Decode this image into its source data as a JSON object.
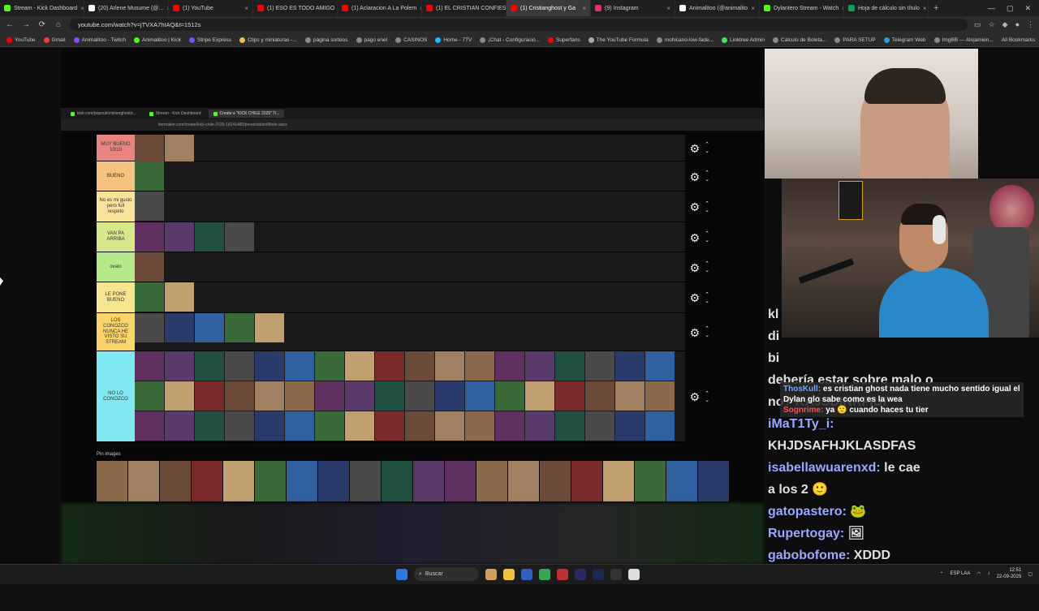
{
  "browser": {
    "tabs": [
      {
        "label": "Stream - Kick Dashboard",
        "color": "#53fc18"
      },
      {
        "label": "(20) Arlene Musume (@...",
        "color": "#ffffff"
      },
      {
        "label": "(1) YouTube",
        "color": "#ff0000"
      },
      {
        "label": "(1) ESO ES TODO AMIGO",
        "color": "#ff0000"
      },
      {
        "label": "(1) Aclaracion A La Polem",
        "color": "#ff0000"
      },
      {
        "label": "(1) EL CRISTIAN CONFIES",
        "color": "#ff0000"
      },
      {
        "label": "(1) Cristianghost y Ga",
        "color": "#ff0000"
      },
      {
        "label": "(9) Instagram",
        "color": "#e1306c"
      },
      {
        "label": "Animalitoo (@animalito",
        "color": "#ffffff"
      },
      {
        "label": "Dylantero Stream - Watch",
        "color": "#53fc18"
      },
      {
        "label": "Hoja de cálculo sin título",
        "color": "#0f9d58"
      }
    ],
    "url": "youtube.com/watch?v=jTVXA7hIAQ&t=1512s",
    "bookmarks": [
      "YouTube",
      "Gmail",
      "Animalitoo - Twitch",
      "Animalitoo | Kick",
      "Stripe Express",
      "Clips y miniaturas -...",
      "página sorteos",
      "pago enel",
      "CASINOS",
      "Home - 7TV",
      "¡Chat - Configuració...",
      "Superfans",
      "The YouTube Formula",
      "mohicano-low-fade...",
      "Linktree Admin",
      "Cálculo de Boleta...",
      "PARA SETUP",
      "Telegram Web",
      "ImgBB — Alojamien..."
    ],
    "all_bookmarks": "All Bookmarks"
  },
  "inner": {
    "tabs": [
      "kick.com/popout/cristianghost/c...",
      "Stream - Kick Dashboard",
      "Create a \"KICK CHILE 2025\" Ti..."
    ],
    "url": "tiermaker.com/create/kick-chile-2025-18241480/presentationMode.aspx"
  },
  "tiers": [
    {
      "label": "MUY BUENO 10/10",
      "color": "#e8837f",
      "count": 2,
      "height": 33
    },
    {
      "label": "BUENO",
      "color": "#f4c27c",
      "count": 1,
      "height": 37
    },
    {
      "label": "No es mi gusto pero full respeto",
      "color": "#f9e29c",
      "count": 1,
      "height": 38
    },
    {
      "label": "VAN PA ARRIBA",
      "color": "#d7e88a",
      "count": 4,
      "height": 37
    },
    {
      "label": "ovalo",
      "color": "#b5ea8c",
      "count": 1,
      "height": 37
    },
    {
      "label": "LE PONE BUENO",
      "color": "#f6e690",
      "count": 2,
      "height": 38
    },
    {
      "label": "LOS CONOZCO NUNCA HE VISTO SU STREAM",
      "color": "#fbd46a",
      "count": 5,
      "height": 47
    },
    {
      "label": "NO LO CONOZCO",
      "color": "#7fe8f0",
      "count": 54,
      "height": 112
    }
  ],
  "pin_images_title": "Pin images",
  "pin_count": 20,
  "chat": {
    "lines": [
      {
        "user": "",
        "text": "kl"
      },
      {
        "user": "",
        "text": "di"
      },
      {
        "user": "",
        "text": "bi"
      },
      {
        "user": "",
        "text": "debería estar sobre malo o"
      },
      {
        "user": "",
        "text": "no? KAJSDINRFIUI"
      },
      {
        "user": "iMaT1Ty_i:",
        "text": ""
      },
      {
        "user": "",
        "text": "KHJDSAFHJKLASDFAS"
      },
      {
        "user": "isabellawuarenxd:",
        "text": " le cae"
      },
      {
        "user": "",
        "text": "a los 2 🙂"
      },
      {
        "user": "gatopastero:",
        "text": " 🐸"
      },
      {
        "user": "Rupertogay:",
        "text": " 🖼"
      },
      {
        "user": "gabobofome:",
        "text": " XDDD"
      }
    ],
    "pinned": [
      {
        "user": "ThosKull:",
        "text": " es cristian ghost nada tiene mucho sentido igual el Dylan glo sabe como es la wea",
        "red": false
      },
      {
        "user": "Sognrime:",
        "text": " ya 🙂 cuando haces tu tier",
        "red": true
      }
    ]
  },
  "taskbar": {
    "search": "Buscar",
    "lang": "ESP LAA",
    "time": "12:51",
    "date": "22-09-2025"
  }
}
